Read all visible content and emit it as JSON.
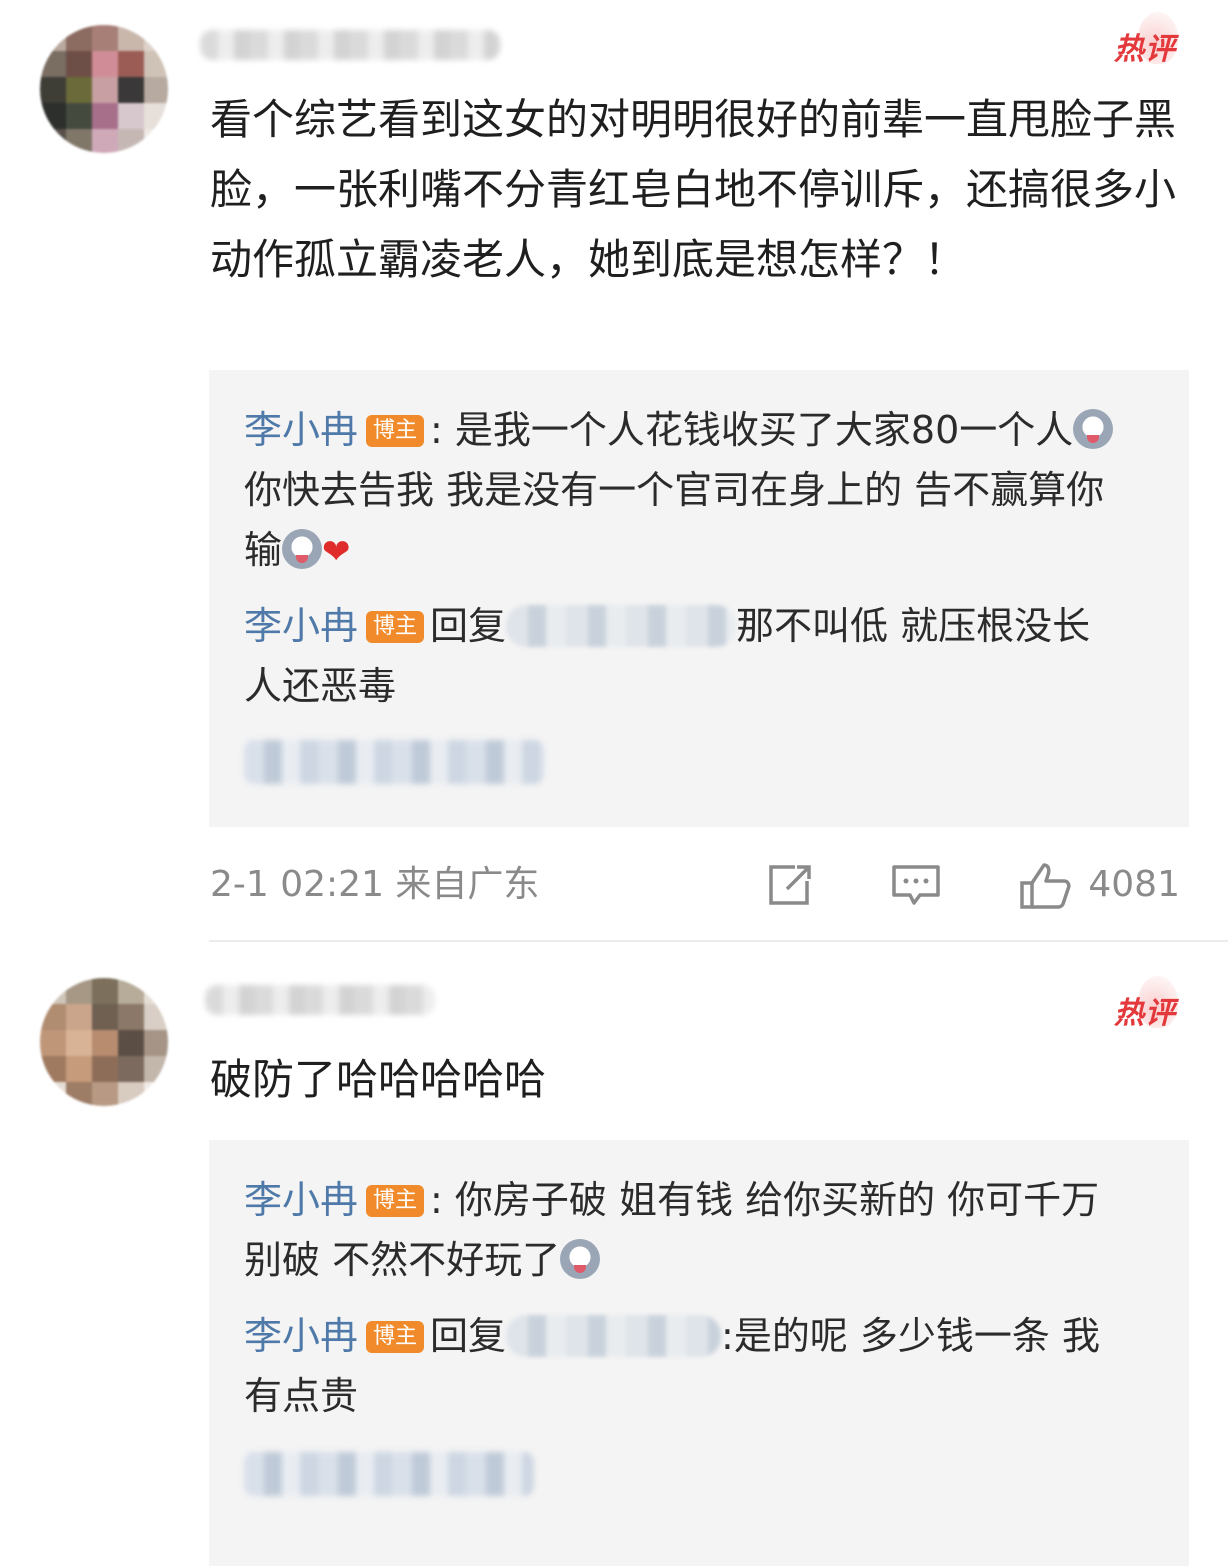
{
  "comments": [
    {
      "badge": "热评",
      "text": "看个综艺看到这女的对明明很好的前辈一直甩脸子黑脸，一张利嘴不分青红皂白地不停训斥，还搞很多小动作孤立霸凌老人，她到底是想怎样？！",
      "replies": [
        {
          "author": "李小冉",
          "tag": "博主",
          "text_a": ": 是我一个人花钱收买了大家80一个人",
          "text_b": "你快去告我 我是没有一个官司在身上的 告不赢算你输"
        },
        {
          "author": "李小冉",
          "tag": "博主",
          "prefix": "回复",
          "text": "那不叫低 就压根没长 人还恶毒"
        }
      ],
      "meta": {
        "time": "2-1 02:21 来自广东",
        "likes": "4081",
        "share_icon": "share-icon",
        "comment_icon": "comment-icon",
        "like_icon": "thumbs-up-icon"
      }
    },
    {
      "badge": "热评",
      "text": "破防了哈哈哈哈哈",
      "replies": [
        {
          "author": "李小冉",
          "tag": "博主",
          "text_a": ": 你房子破 姐有钱 给你买新的 你可千万别破 不然不好玩了"
        },
        {
          "author": "李小冉",
          "tag": "博主",
          "prefix": "回复",
          "text": ":是的呢 多少钱一条 我有点贵"
        }
      ]
    }
  ],
  "colors": {
    "author": "#4e79a8",
    "tag_bg": "#f08a2a",
    "hot": "#e4393c",
    "reply_bg": "#f4f4f4"
  }
}
